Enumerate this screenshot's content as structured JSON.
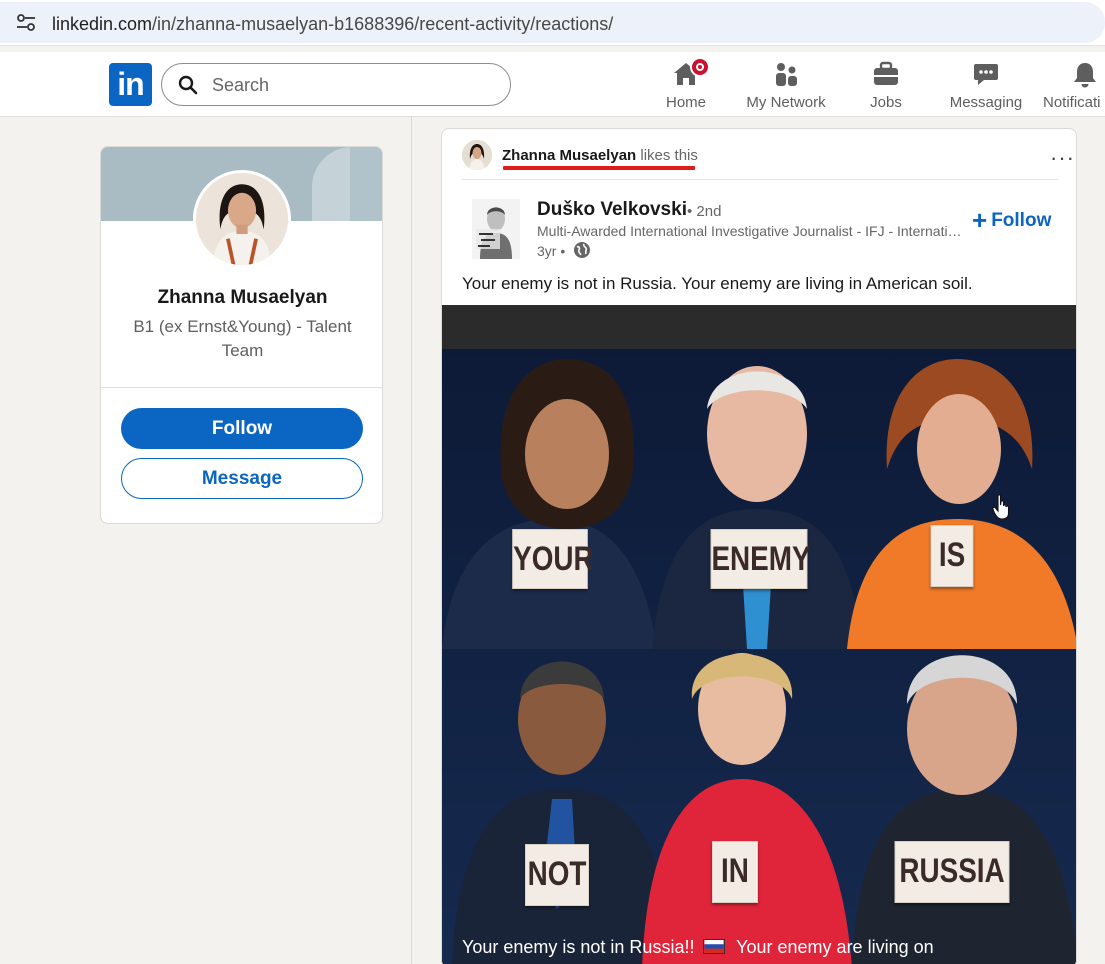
{
  "browser": {
    "url_host": "linkedin.com",
    "url_path": "/in/zhanna-musaelyan-b1688396/recent-activity/reactions/"
  },
  "nav": {
    "logo_text": "in",
    "search_placeholder": "Search",
    "items": [
      {
        "label": "Home",
        "icon": "home-icon",
        "badge": true
      },
      {
        "label": "My Network",
        "icon": "network-icon"
      },
      {
        "label": "Jobs",
        "icon": "briefcase-icon"
      },
      {
        "label": "Messaging",
        "icon": "message-icon"
      },
      {
        "label": "Notificati",
        "icon": "bell-icon"
      }
    ]
  },
  "profile": {
    "name": "Zhanna Musaelyan",
    "headline": "B1 (ex Ernst&Young) - Talent Team",
    "follow_label": "Follow",
    "message_label": "Message"
  },
  "post": {
    "reactor_name": "Zhanna Musaelyan",
    "reaction_text": "likes this",
    "more_label": "···",
    "author_name": "Duško Velkovski",
    "author_degree": "• 2nd",
    "author_title": "Multi-Awarded International Investigative Journalist - IFJ - International Federation of Journalists",
    "age": "3yr •",
    "follow_label": "Follow",
    "text": "Your enemy is not in Russia. Your enemy are living in American soil.",
    "image_signs": [
      "YOUR",
      "ENEMY",
      "IS",
      "NOT",
      "IN",
      "RUSSIA"
    ],
    "image_caption_a": "Your enemy is not in Russia!!",
    "image_caption_b": "Your enemy are living on"
  },
  "colors": {
    "brand": "#0a66c2",
    "badge": "#cb112d",
    "highlight_underline": "#e01b1b",
    "page_bg": "#f4f2ee"
  }
}
